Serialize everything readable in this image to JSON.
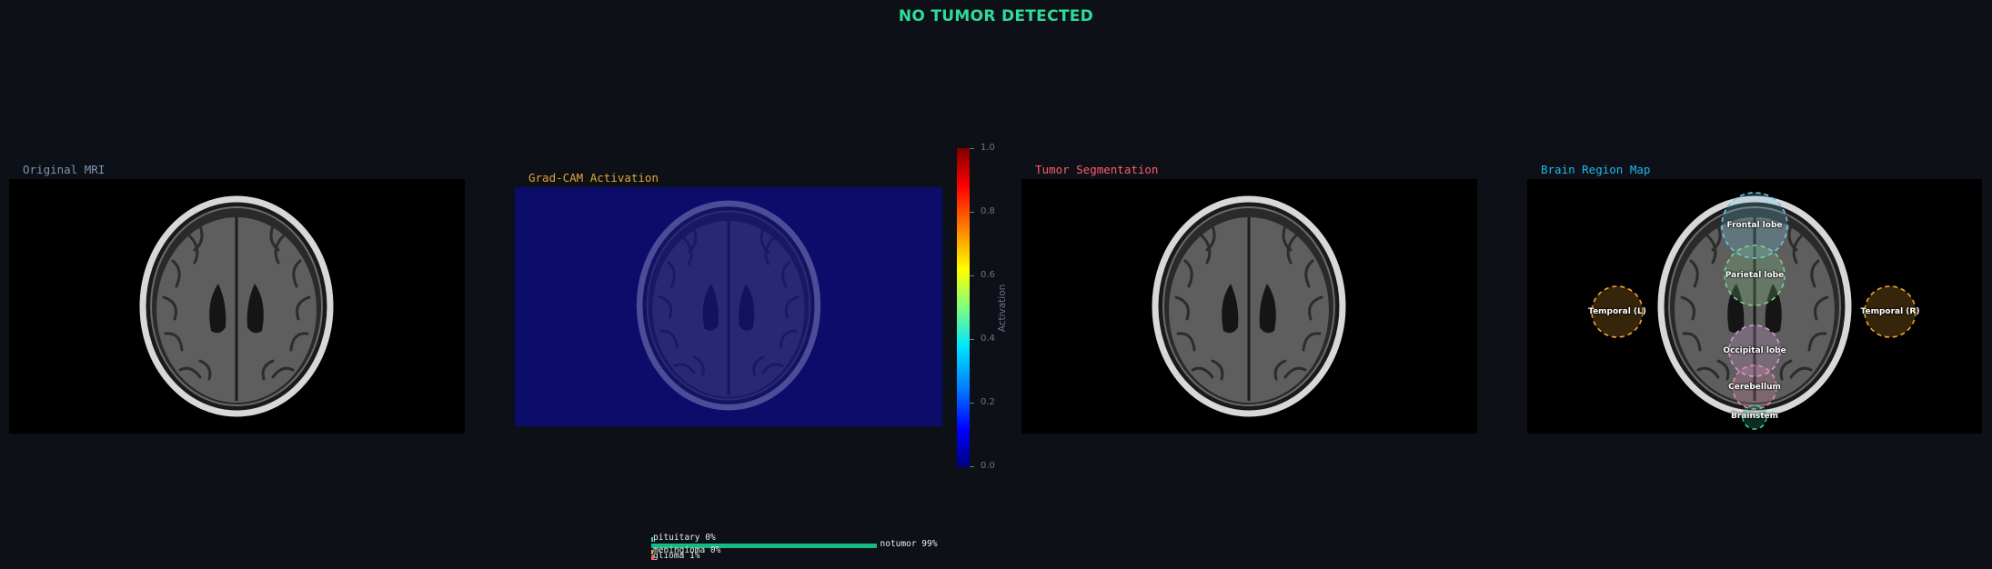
{
  "header": {
    "title": "NO TUMOR DETECTED",
    "title_color": "#2ddc9b"
  },
  "panels": {
    "original": {
      "title": "Original MRI",
      "title_color": "#7f93ad"
    },
    "gradcam": {
      "title": "Grad-CAM Activation",
      "title_color": "#e0a53a",
      "colorbar": {
        "label": "Activation",
        "ticks": [
          "1.0",
          "0.8",
          "0.6",
          "0.4",
          "0.2",
          "0.0"
        ],
        "colormap": "jet"
      }
    },
    "segmentation": {
      "title": "Tumor Segmentation",
      "title_color": "#ff5c6c"
    },
    "region_map": {
      "title": "Brain Region Map",
      "title_color": "#1fb8ea",
      "regions": [
        {
          "name": "Frontal lobe",
          "icon": "dashed-circle",
          "color": "#6ec7e8"
        },
        {
          "name": "Parietal lobe",
          "icon": "dashed-circle",
          "color": "#7fd08a"
        },
        {
          "name": "Temporal (L)",
          "icon": "dashed-circle",
          "color": "#f0a830"
        },
        {
          "name": "Temporal (R)",
          "icon": "dashed-circle",
          "color": "#f0a830"
        },
        {
          "name": "Occipital lobe",
          "icon": "dashed-circle",
          "color": "#d69ad8"
        },
        {
          "name": "Cerebellum",
          "icon": "dashed-circle",
          "color": "#e58ab0"
        },
        {
          "name": "Brainstem",
          "icon": "dashed-circle",
          "color": "#3ccf9a"
        }
      ]
    }
  },
  "probabilities": [
    {
      "label": "pituitary 0%",
      "fraction": 0.0,
      "color": "#2ddc9b"
    },
    {
      "label": "notumor 99%",
      "fraction": 0.99,
      "color": "#17b982"
    },
    {
      "label": "meningioma 0%",
      "fraction": 0.0,
      "color": "#e0a53a"
    },
    {
      "label": "glioma 1%",
      "fraction": 0.01,
      "color": "#ff5c6c"
    }
  ]
}
